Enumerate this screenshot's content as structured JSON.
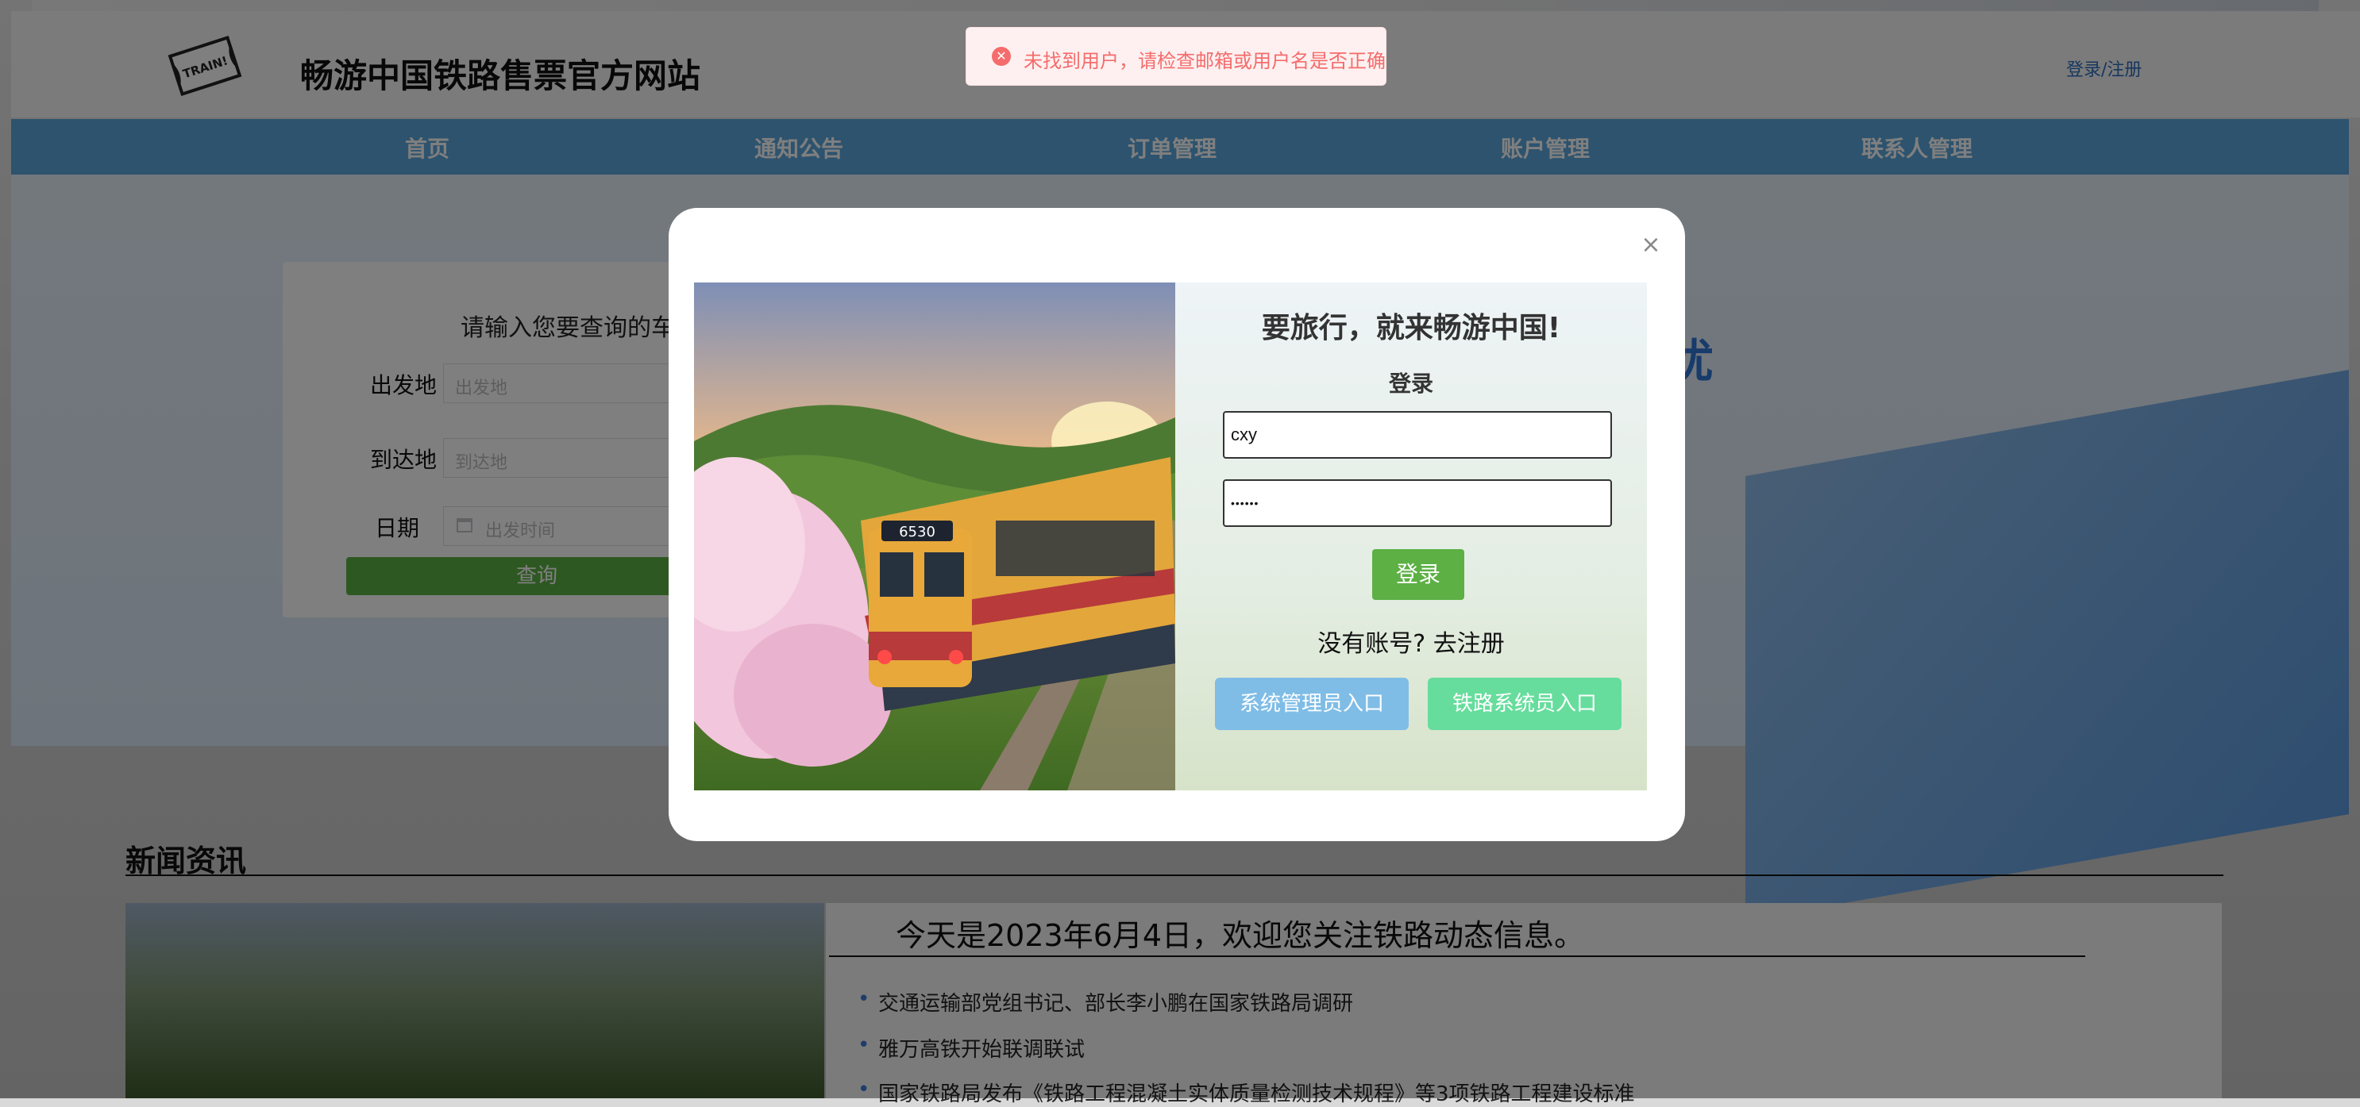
{
  "toast": {
    "message": "未找到用户，请检查邮箱或用户名是否正确",
    "icon": "error-circle-icon"
  },
  "header": {
    "site_title": "畅游中国铁路售票官方网站",
    "login_link": "登录/注册",
    "logo_text": "TRAIN!"
  },
  "nav": {
    "items": [
      "首页",
      "通知公告",
      "订单管理",
      "账户管理",
      "联系人管理"
    ]
  },
  "hero": {
    "slogan_fragment": "忧"
  },
  "search": {
    "title": "请输入您要查询的车",
    "departure_label": "出发地",
    "departure_placeholder": "出发地",
    "arrival_label": "到达地",
    "arrival_placeholder": "到达地",
    "date_label": "日期",
    "date_placeholder": "出发时间",
    "query_button": "查询"
  },
  "news": {
    "section_title": "新闻资讯",
    "headline": "今天是2023年6月4日，欢迎您关注铁路动态信息。",
    "items": [
      "交通运输部党组书记、部长李小鹏在国家铁路局调研",
      "雅万高铁开始联调联试",
      "国家铁路局发布《铁路工程混凝土实体质量检测技术规程》等3项铁路工程建设标准"
    ]
  },
  "login_modal": {
    "slogan": "要旅行，就来畅游中国!",
    "title": "登录",
    "username_value": "cxy",
    "password_value": "••••••",
    "login_button": "登录",
    "register_link": "没有账号? 去注册",
    "admin_button": "系统管理员入口",
    "railway_button": "铁路系统员入口",
    "train_number": "6530"
  },
  "colors": {
    "nav_bg": "#5aa7dd",
    "primary_green": "#5cb044",
    "admin_blue": "#7fbde6",
    "railway_green": "#66dd9c",
    "toast_red": "#f56c6c",
    "link_blue": "#2f6fbf"
  }
}
